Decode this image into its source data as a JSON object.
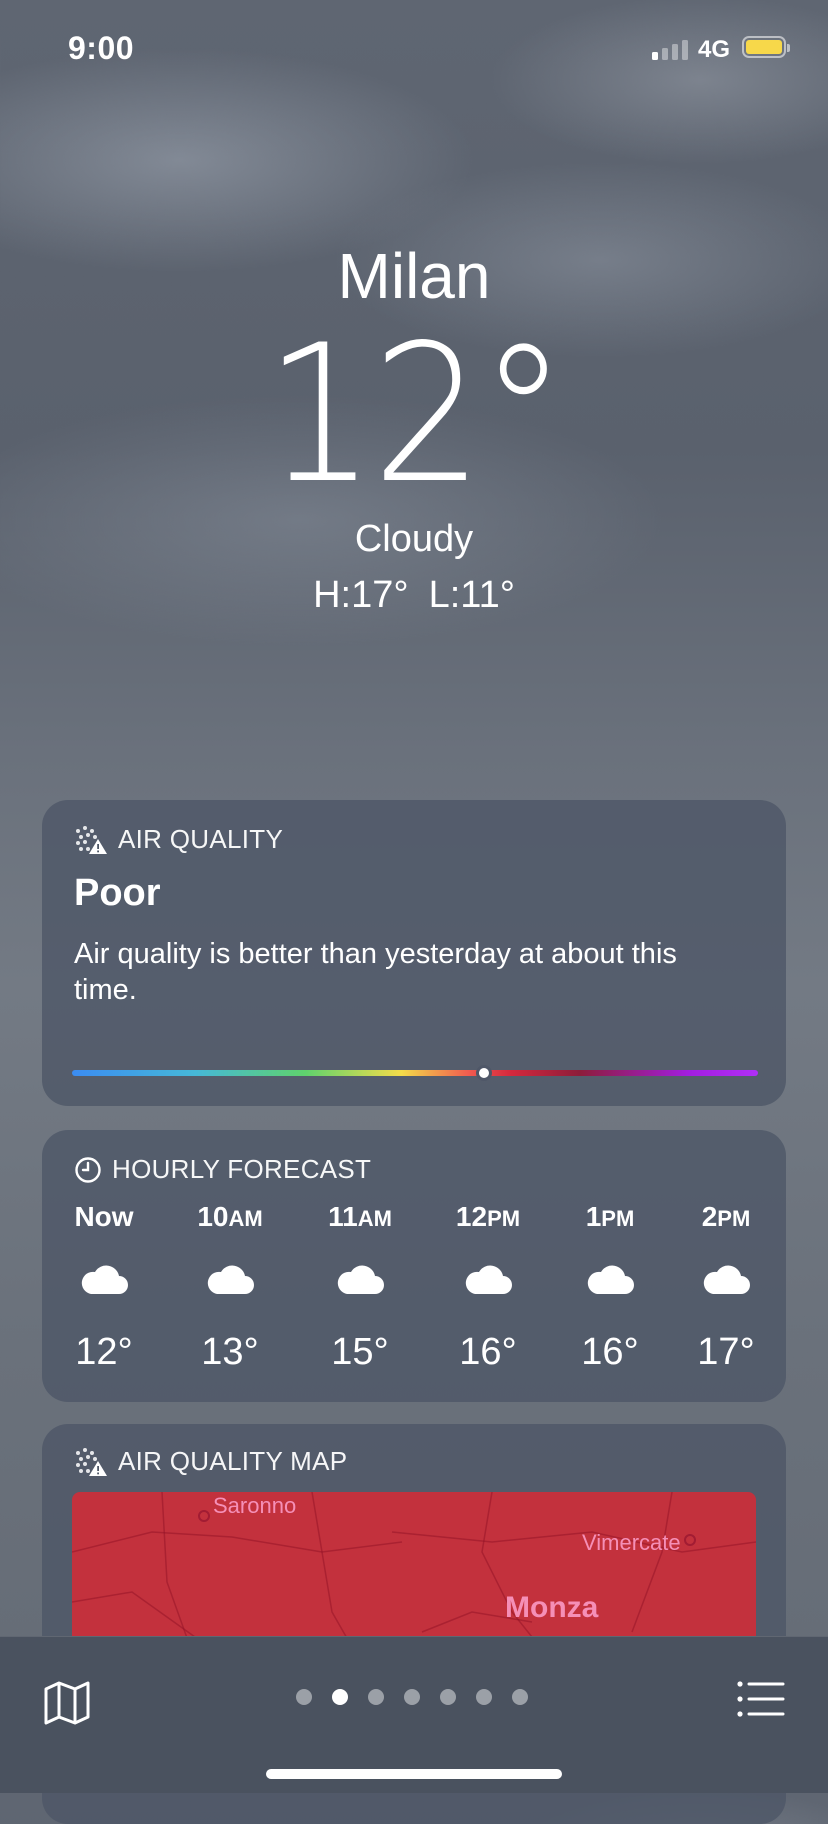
{
  "status_bar": {
    "time": "9:00",
    "network": "4G",
    "battery_color": "#f7d84a"
  },
  "location": {
    "city": "Milan",
    "temperature": "12°",
    "condition": "Cloudy",
    "high": "H:17°",
    "low": "L:11°"
  },
  "air_quality": {
    "title": "AIR QUALITY",
    "level": "Poor",
    "description": "Air quality is better than yesterday at about this time.",
    "scale_position": 0.6
  },
  "hourly": {
    "title": "HOURLY FORECAST",
    "items": [
      {
        "time": "Now",
        "suffix": "",
        "icon": "cloud-icon",
        "temp": "12°"
      },
      {
        "time": "10",
        "suffix": "AM",
        "icon": "cloud-icon",
        "temp": "13°"
      },
      {
        "time": "11",
        "suffix": "AM",
        "icon": "cloud-icon",
        "temp": "15°"
      },
      {
        "time": "12",
        "suffix": "PM",
        "icon": "cloud-icon",
        "temp": "16°"
      },
      {
        "time": "1",
        "suffix": "PM",
        "icon": "cloud-icon",
        "temp": "16°"
      },
      {
        "time": "2",
        "suffix": "PM",
        "icon": "cloud-icon",
        "temp": "17°"
      }
    ]
  },
  "air_quality_map": {
    "title": "AIR QUALITY MAP",
    "labels": {
      "saronno": "Saronno",
      "vimercate": "Vimercate",
      "monza": "Monza"
    },
    "color": "#c3313d"
  },
  "toolbar": {
    "page_count": 7,
    "active_page": 1
  }
}
